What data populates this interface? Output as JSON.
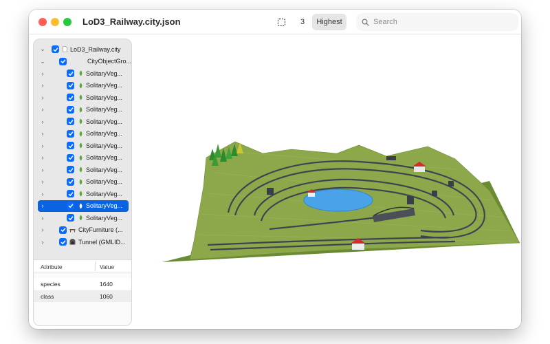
{
  "window": {
    "title": "LoD3_Railway.city.json"
  },
  "toolbar": {
    "lod_number": "3",
    "lod_label": "Highest",
    "search_placeholder": "Search"
  },
  "tree": {
    "root": "LoD3_Railway.city",
    "group": "CityObjectGro...",
    "items": [
      "SolitaryVeg...",
      "SolitaryVeg...",
      "SolitaryVeg...",
      "SolitaryVeg...",
      "SolitaryVeg...",
      "SolitaryVeg...",
      "SolitaryVeg...",
      "SolitaryVeg...",
      "SolitaryVeg...",
      "SolitaryVeg...",
      "SolitaryVeg...",
      "SolitaryVeg...",
      "SolitaryVeg..."
    ],
    "furniture": "CityFurniture (...",
    "tunnel": "Tunnel (GMLID..."
  },
  "attributes": {
    "headers": {
      "attribute": "Attribute",
      "value": "Value"
    },
    "rows": [
      {
        "key": "species",
        "value": "1640"
      },
      {
        "key": "class",
        "value": "1060"
      }
    ]
  },
  "colors": {
    "accent": "#0a63e0",
    "terrain": "#7d9a3c",
    "lake": "#4aa3e8",
    "house_roof": "#d42a2a"
  },
  "icons": {
    "selection": "selection-box-icon",
    "search": "search-icon",
    "vegetation": "leaf-icon",
    "file": "file-icon",
    "furniture": "bench-icon",
    "tunnel": "tunnel-icon"
  }
}
